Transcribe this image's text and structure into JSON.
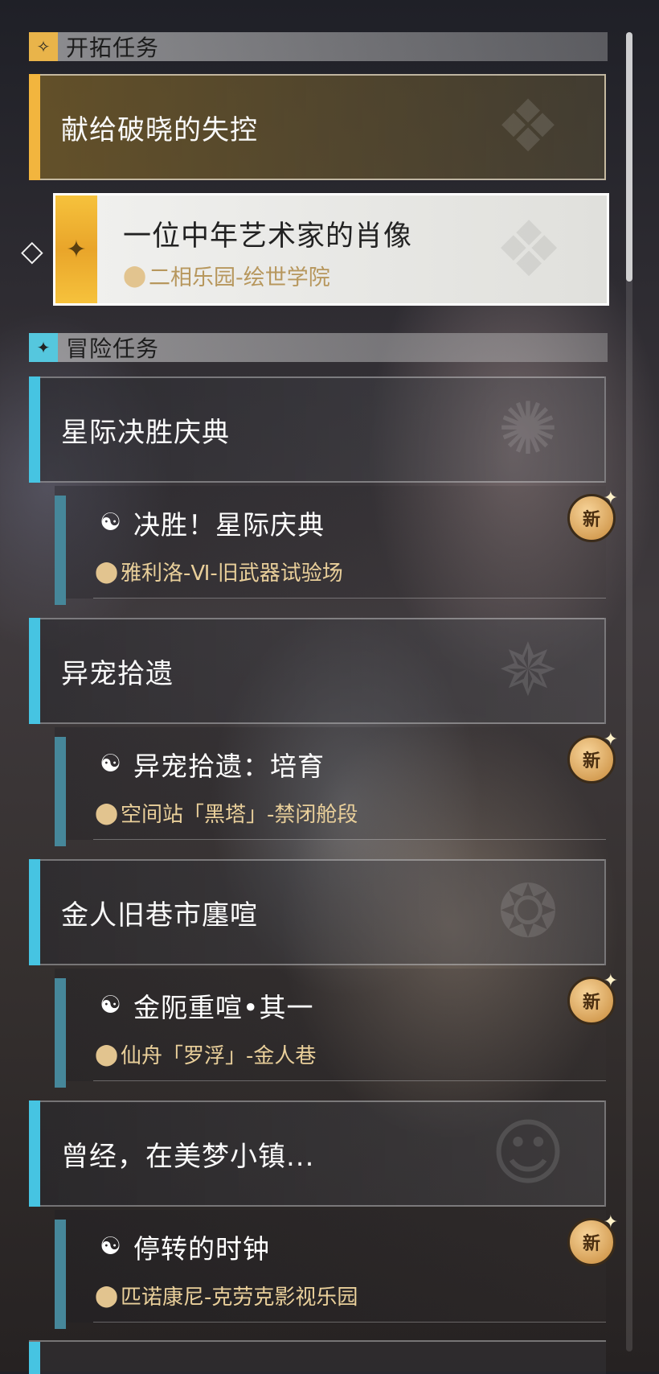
{
  "sections": {
    "trailblaze": {
      "label": "开拓任务",
      "icon": "diamond-sparkle-icon",
      "accent": "#e9b44a"
    },
    "adventure": {
      "label": "冒险任务",
      "icon": "star-sparkle-icon",
      "accent": "#55c7de"
    }
  },
  "trailblaze_mission": {
    "title": "献给破晓的失控",
    "selected_quest": {
      "title": "一位中年艺术家的肖像",
      "location": "二相乐园-绘世学院"
    }
  },
  "adventure_missions": [
    {
      "title": "星际决胜庆典",
      "quest": {
        "title": "决胜！星际庆典",
        "location": "雅利洛-Ⅵ-旧武器试验场",
        "badge": "新"
      }
    },
    {
      "title": "异宠拾遗",
      "quest": {
        "title": "异宠拾遗：培育",
        "location": "空间站「黑塔」-禁闭舱段",
        "badge": "新"
      }
    },
    {
      "title": "金人旧巷市廛喧",
      "quest": {
        "title": "金阨重喧•其一",
        "location": "仙舟「罗浮」-金人巷",
        "badge": "新"
      }
    },
    {
      "title": "曾经，在美梦小镇...",
      "quest": {
        "title": "停转的时钟",
        "location": "匹诺康尼-克劳克影视乐园",
        "badge": "新"
      }
    }
  ],
  "colors": {
    "gold": "#f2b53e",
    "blue": "#46c4e2",
    "location_text": "#e9cf9a"
  }
}
